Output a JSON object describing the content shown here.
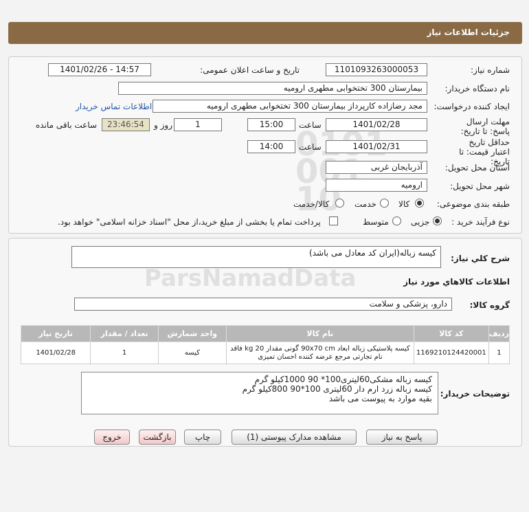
{
  "header": {
    "title": "جزئیات اطلاعات نیاز"
  },
  "fields": {
    "need_number_label": "شماره نیاز:",
    "need_number": "1101093263000053",
    "announce_label": "تاریخ و ساعت اعلان عمومی:",
    "announce_value": "1401/02/26 - 14:57",
    "buyer_org_label": "نام دستگاه خریدار:",
    "buyer_org": "بیمارستان 300 تختخوابی مطهری  ارومیه",
    "requester_label": "ایجاد کننده درخواست:",
    "requester": "مجد رضازاده کارپرداز بیمارستان 300 تختخوابی مطهری  ارومیه",
    "contact_link": "اطلاعات تماس خریدار",
    "deadline_label": "مهلت ارسال پاسخ: تا تاریخ:",
    "deadline_date": "1401/02/28",
    "time_label": "ساعت",
    "deadline_time": "15:00",
    "days_value": "1",
    "days_label": "روز و",
    "remaining_time": "23:46:54",
    "remaining_label": "ساعت باقی مانده",
    "validity_label": "حداقل تاریخ اعتبار قیمت: تا تاریخ:",
    "validity_date": "1401/02/31",
    "validity_time_label": "ساعت",
    "validity_time": "14:00",
    "province_label": "استان محل تحویل:",
    "province": "آذربایجان غربی",
    "city_label": "شهر محل تحویل:",
    "city": "ارومیه",
    "category_label": "طبقه بندی موضوعی:",
    "category_options": [
      "کالا",
      "خدمت",
      "کالا/خدمت"
    ],
    "process_label": "نوع فرآیند خرید :",
    "process_options": [
      "جزیی",
      "متوسط"
    ],
    "payment_note": "پرداخت تمام یا بخشی از مبلغ خرید،از محل \"اسناد خزانه اسلامی\" خواهد بود."
  },
  "summary": {
    "label": "شرح کلي نياز:",
    "value": "کیسه زباله(ایران کد معادل می باشد)"
  },
  "goods_info_title": "اطلاعات کالاهاي مورد نياز",
  "goods_group": {
    "label": "گروه کالا:",
    "value": "دارو، پزشکی و سلامت"
  },
  "table": {
    "headers": [
      "ردیف",
      "کد کالا",
      "نام کالا",
      "واحد شمارش",
      "تعداد / مقدار",
      "تاریخ نیاز"
    ],
    "rows": [
      {
        "row": "1",
        "code": "1169210124420001",
        "name": "کیسه پلاستیکی زباله ابعاد 90x70 cm گونی مقدار 20 kg فاقد نام تجارتی مرجع عرضه کننده احسان تمیزی",
        "unit": "کیسه",
        "qty": "1",
        "date": "1401/02/28"
      }
    ]
  },
  "buyer_desc": {
    "label": "توضیحات خریدار:",
    "line1": "کیسه زباله مشکی60لیتری100* 90            1000کیلو گرم",
    "line2": "کیسه زباله زرد ارم دار 60لیتری 100*90          800کیلو گرم",
    "line3": "بقیه موارد به پیوست می باشد"
  },
  "buttons": {
    "reply": "پاسخ به نیاز",
    "attachments": "مشاهده مدارک پیوستی (1)",
    "print": "چاپ",
    "back": "بازگشت",
    "exit": "خروج"
  },
  "colors": {
    "header": "#8a6a45",
    "link": "#2456a8",
    "timer_bg": "#e8e2c4"
  }
}
